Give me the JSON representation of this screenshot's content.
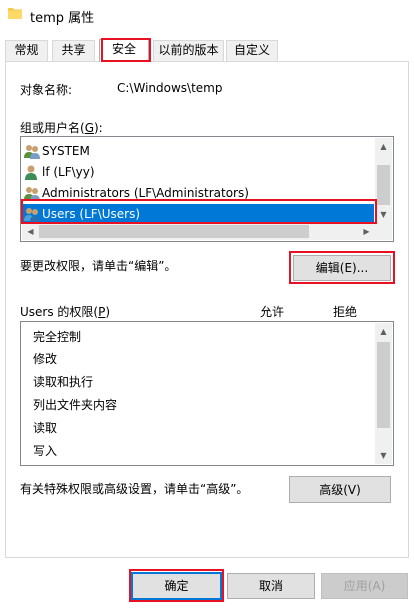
{
  "window": {
    "title": "temp 属性"
  },
  "tabs": [
    {
      "label": "常规"
    },
    {
      "label": "共享"
    },
    {
      "label": "安全"
    },
    {
      "label": "以前的版本"
    },
    {
      "label": "自定义"
    }
  ],
  "security": {
    "object_name_label": "对象名称:",
    "object_name_value": "C:\\Windows\\temp",
    "group_label_pre": "组或用户名(",
    "group_label_key": "G",
    "group_label_post": "):",
    "users": [
      {
        "name": "SYSTEM"
      },
      {
        "name": "lf (LF\\yy)"
      },
      {
        "name": "Administrators (LF\\Administrators)"
      },
      {
        "name": "Users (LF\\Users)"
      }
    ],
    "change_hint": "要更改权限，请单击“编辑”。",
    "edit_button": "编辑(E)...",
    "perm_label_pre": "Users 的权限(",
    "perm_label_key": "P",
    "perm_label_post": ")",
    "allow_header": "允许",
    "deny_header": "拒绝",
    "permissions": [
      {
        "name": "完全控制"
      },
      {
        "name": "修改"
      },
      {
        "name": "读取和执行"
      },
      {
        "name": "列出文件夹内容"
      },
      {
        "name": "读取"
      },
      {
        "name": "写入"
      }
    ],
    "advanced_hint": "有关特殊权限或高级设置，请单击“高级”。",
    "advanced_button": "高级(V)"
  },
  "footer": {
    "ok": "确定",
    "cancel": "取消",
    "apply": "应用(A)"
  },
  "colors": {
    "selection": "#0078d7",
    "highlight_box": "#e81123"
  }
}
